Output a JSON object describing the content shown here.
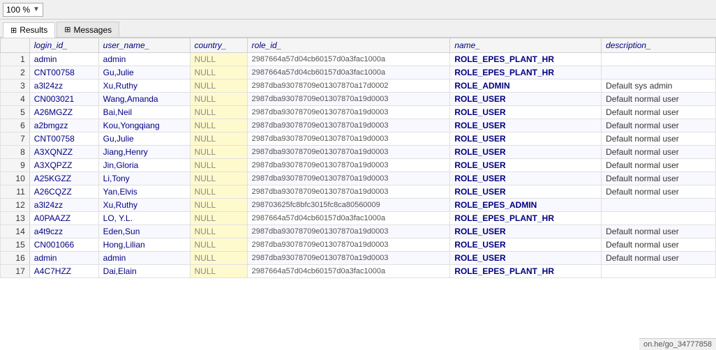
{
  "toolbar": {
    "zoom_label": "100 %",
    "zoom_arrow": "▼"
  },
  "tabs": [
    {
      "id": "results",
      "label": "Results",
      "icon": "⊞",
      "active": true
    },
    {
      "id": "messages",
      "label": "Messages",
      "icon": "⊞",
      "active": false
    }
  ],
  "table": {
    "columns": [
      {
        "id": "row_num",
        "label": ""
      },
      {
        "id": "login_id",
        "label": "login_id_"
      },
      {
        "id": "user_name",
        "label": "user_name_"
      },
      {
        "id": "country",
        "label": "country_"
      },
      {
        "id": "role_id",
        "label": "role_id_"
      },
      {
        "id": "name",
        "label": "name_"
      },
      {
        "id": "description",
        "label": "description_"
      }
    ],
    "rows": [
      {
        "row": 1,
        "login_id": "admin",
        "user_name": "admin",
        "country": "NULL",
        "role_id": "2987664a57d04cb60157d0a3fac1000a",
        "name": "ROLE_EPES_PLANT_HR",
        "description": ""
      },
      {
        "row": 2,
        "login_id": "CNT00758",
        "user_name": "Gu,Julie",
        "country": "NULL",
        "role_id": "2987664a57d04cb60157d0a3fac1000a",
        "name": "ROLE_EPES_PLANT_HR",
        "description": ""
      },
      {
        "row": 3,
        "login_id": "a3l24zz",
        "user_name": "Xu,Ruthy",
        "country": "NULL",
        "role_id": "2987dba93078709e01307870a17d0002",
        "name": "ROLE_ADMIN",
        "description": "Default sys admin"
      },
      {
        "row": 4,
        "login_id": "CN003021",
        "user_name": "Wang,Amanda",
        "country": "NULL",
        "role_id": "2987dba93078709e01307870a19d0003",
        "name": "ROLE_USER",
        "description": "Default normal user"
      },
      {
        "row": 5,
        "login_id": "A26MGZZ",
        "user_name": "Bai,Neil",
        "country": "NULL",
        "role_id": "2987dba93078709e01307870a19d0003",
        "name": "ROLE_USER",
        "description": "Default normal user"
      },
      {
        "row": 6,
        "login_id": "a2bmgzz",
        "user_name": "Kou,Yongqiang",
        "country": "NULL",
        "role_id": "2987dba93078709e01307870a19d0003",
        "name": "ROLE_USER",
        "description": "Default normal user"
      },
      {
        "row": 7,
        "login_id": "CNT00758",
        "user_name": "Gu,Julie",
        "country": "NULL",
        "role_id": "2987dba93078709e01307870a19d0003",
        "name": "ROLE_USER",
        "description": "Default normal user"
      },
      {
        "row": 8,
        "login_id": "A3XQNZZ",
        "user_name": "Jiang,Henry",
        "country": "NULL",
        "role_id": "2987dba93078709e01307870a19d0003",
        "name": "ROLE_USER",
        "description": "Default normal user"
      },
      {
        "row": 9,
        "login_id": "A3XQPZZ",
        "user_name": "Jin,Gloria",
        "country": "NULL",
        "role_id": "2987dba93078709e01307870a19d0003",
        "name": "ROLE_USER",
        "description": "Default normal user"
      },
      {
        "row": 10,
        "login_id": "A25KGZZ",
        "user_name": "Li,Tony",
        "country": "NULL",
        "role_id": "2987dba93078709e01307870a19d0003",
        "name": "ROLE_USER",
        "description": "Default normal user"
      },
      {
        "row": 11,
        "login_id": "A26CQZZ",
        "user_name": "Yan,Elvis",
        "country": "NULL",
        "role_id": "2987dba93078709e01307870a19d0003",
        "name": "ROLE_USER",
        "description": "Default normal user"
      },
      {
        "row": 12,
        "login_id": "a3l24zz",
        "user_name": "Xu,Ruthy",
        "country": "NULL",
        "role_id": "298703625fc8bfc3015fc8ca80560009",
        "name": "ROLE_EPES_ADMIN",
        "description": ""
      },
      {
        "row": 13,
        "login_id": "A0PAAZZ",
        "user_name": "LO, Y.L.",
        "country": "NULL",
        "role_id": "2987664a57d04cb60157d0a3fac1000a",
        "name": "ROLE_EPES_PLANT_HR",
        "description": ""
      },
      {
        "row": 14,
        "login_id": "a4t9czz",
        "user_name": "Eden,Sun",
        "country": "NULL",
        "role_id": "2987dba93078709e01307870a19d0003",
        "name": "ROLE_USER",
        "description": "Default normal user"
      },
      {
        "row": 15,
        "login_id": "CN001066",
        "user_name": "Hong,Lilian",
        "country": "NULL",
        "role_id": "2987dba93078709e01307870a19d0003",
        "name": "ROLE_USER",
        "description": "Default normal user"
      },
      {
        "row": 16,
        "login_id": "admin",
        "user_name": "admin",
        "country": "NULL",
        "role_id": "2987dba93078709e01307870a19d0003",
        "name": "ROLE_USER",
        "description": "Default normal user"
      },
      {
        "row": 17,
        "login_id": "A4C7HZZ",
        "user_name": "Dai,Elain",
        "country": "NULL",
        "role_id": "2987664a57d04cb60157d0a3fac1000a",
        "name": "ROLE_EPES_PLANT_HR",
        "description": ""
      }
    ]
  },
  "bottom_bar": {
    "text": "on.he/go_34777858"
  }
}
